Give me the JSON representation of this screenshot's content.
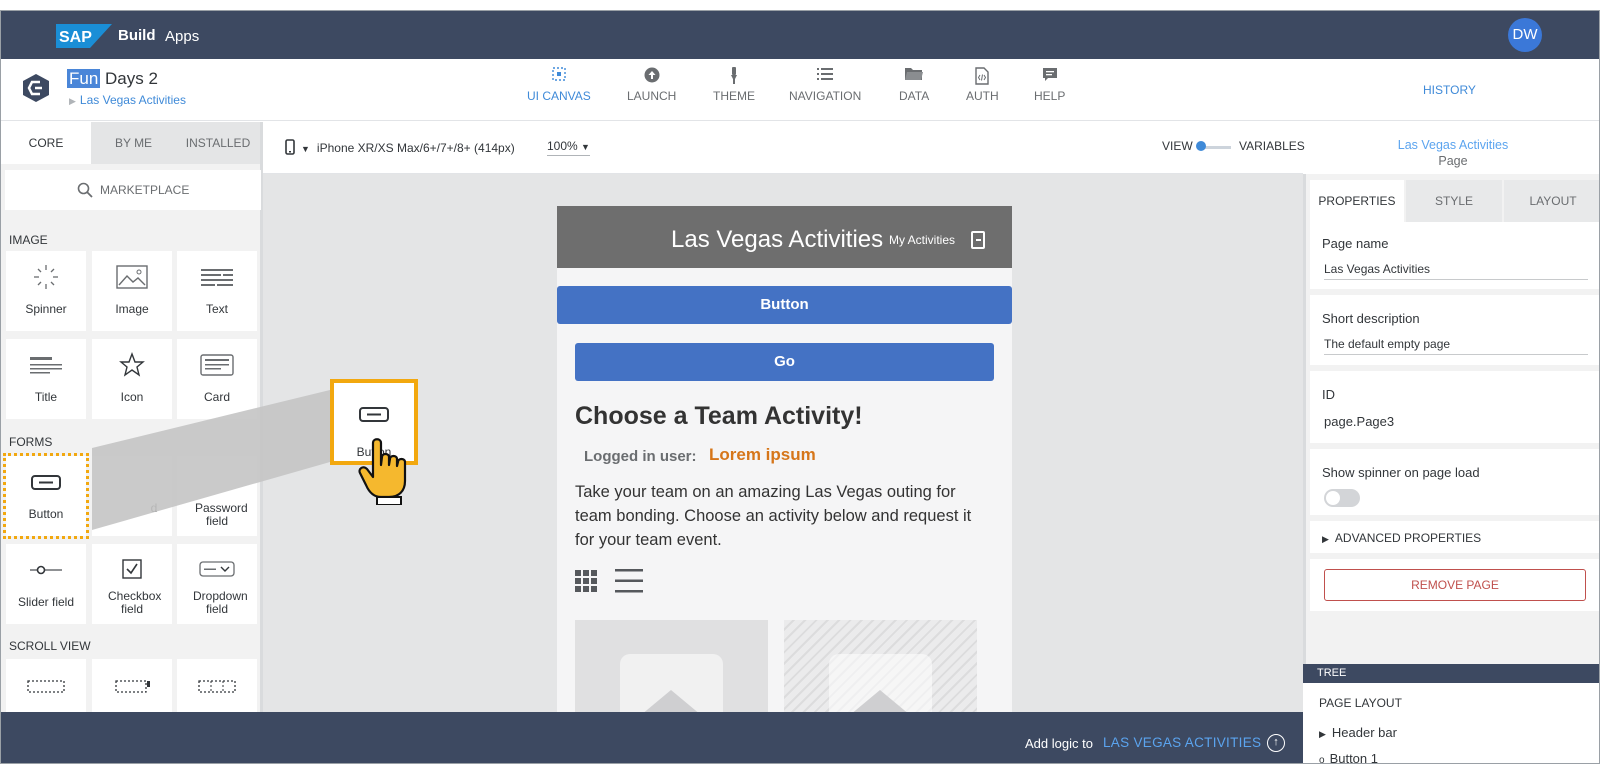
{
  "shell": {
    "brand_logo": "SAP",
    "brand_build": "Build",
    "brand_apps": "Apps",
    "avatar_initials": "DW"
  },
  "app": {
    "title_highlight": "Fun",
    "title_rest": " Days 2",
    "breadcrumb": "Las Vegas Activities"
  },
  "nav_tabs": [
    {
      "label": "UI CANVAS",
      "icon": "canvas-icon",
      "active": true
    },
    {
      "label": "LAUNCH",
      "icon": "launch-icon"
    },
    {
      "label": "THEME",
      "icon": "brush-icon"
    },
    {
      "label": "NAVIGATION",
      "icon": "list-icon"
    },
    {
      "label": "DATA",
      "icon": "folder-icon"
    },
    {
      "label": "AUTH",
      "icon": "auth-document-icon"
    },
    {
      "label": "HELP",
      "icon": "chat-bubble-icon"
    }
  ],
  "history_label": "HISTORY",
  "palette": {
    "tabs": [
      "CORE",
      "BY ME",
      "INSTALLED"
    ],
    "marketplace": "MARKETPLACE",
    "sections": {
      "image": "IMAGE",
      "forms": "FORMS",
      "scroll": "SCROLL VIEW"
    },
    "tiles": {
      "spinner": "Spinner",
      "image": "Image",
      "text": "Text",
      "title": "Title",
      "icon": "Icon",
      "card": "Card",
      "button": "Button",
      "input_partial": "d",
      "password": "Password field",
      "slider": "Slider field",
      "checkbox": "Checkbox field",
      "dropdown": "Dropdown field"
    }
  },
  "canvas_bar": {
    "device": "iPhone XR/XS Max/6+/7+/8+ (414px)",
    "zoom": "100%",
    "view_label": "VIEW",
    "variables_label": "VARIABLES"
  },
  "phone": {
    "header_title": "Las Vegas Activities",
    "header_link": "My Activities",
    "button1": "Button",
    "button2": "Go",
    "heading": "Choose a Team Activity!",
    "logged_label": "Logged in user:",
    "logged_value": "Lorem ipsum",
    "body": "Take your team on an amazing Las Vegas outing for team bonding. Choose an activity below and request it for your team event."
  },
  "drag": {
    "label": "Button"
  },
  "properties": {
    "page_title": "Las Vegas Activities",
    "page_type": "Page",
    "tabs": [
      "PROPERTIES",
      "STYLE",
      "LAYOUT"
    ],
    "page_name_label": "Page name",
    "page_name_value": "Las Vegas Activities",
    "short_desc_label": "Short description",
    "short_desc_value": "The default empty page",
    "id_label": "ID",
    "id_value": "page.Page3",
    "spinner_label": "Show spinner on page load",
    "spinner_on": false,
    "advanced_label": "ADVANCED PROPERTIES",
    "remove_label": "REMOVE PAGE"
  },
  "tree": {
    "bar_label": "TREE",
    "page_layout": "PAGE LAYOUT",
    "items": [
      "Header bar",
      "Button 1"
    ]
  },
  "bottom": {
    "add_logic": "Add logic to",
    "target": "LAS VEGAS ACTIVITIES"
  },
  "colors": {
    "shell": "#3d4961",
    "accent": "#3f8ad8",
    "phone_button": "#4472c4",
    "drag_highlight": "#f2a80f",
    "lorem": "#d6761a",
    "remove": "#c0504d"
  }
}
